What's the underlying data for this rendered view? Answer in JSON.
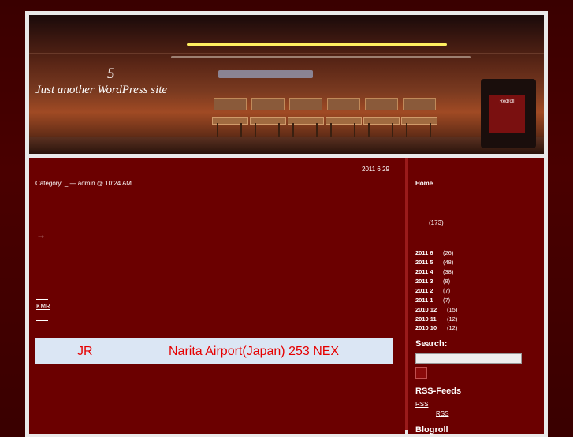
{
  "header": {
    "title": "5",
    "description": "Just another WordPress site",
    "sign_text": "Redroll"
  },
  "post": {
    "date": "2011  6  29",
    "meta": "Category:  _  — admin @ 10:24 AM",
    "arrow": "→",
    "kmr_link": "KMR",
    "banner": {
      "jr": "JR",
      "narita": "Narita Airport(Japan)   253 NEX"
    }
  },
  "sidebar": {
    "home": "Home",
    "count": "(173)",
    "archives": [
      {
        "label": "2011   6",
        "count": "(26)"
      },
      {
        "label": "2011   5",
        "count": "(48)"
      },
      {
        "label": "2011   4",
        "count": "(38)"
      },
      {
        "label": "2011   3",
        "count": "(8)"
      },
      {
        "label": "2011   2",
        "count": "(7)"
      },
      {
        "label": "2011   1",
        "count": "(7)"
      },
      {
        "label": "2010   12",
        "count": "(15)"
      },
      {
        "label": "2010   11",
        "count": "(12)"
      },
      {
        "label": "2010   10",
        "count": "(12)"
      }
    ],
    "search_heading": "Search:",
    "search_value": "",
    "rss_heading": "RSS-Feeds",
    "rss_links": [
      "RSS",
      "RSS"
    ],
    "blogroll_heading": "Blogroll"
  },
  "colors": {
    "content_bg": "#6b0000",
    "page_bg": "#3a0000",
    "banner_bg": "#dbe6f4",
    "banner_text": "#e60000"
  }
}
